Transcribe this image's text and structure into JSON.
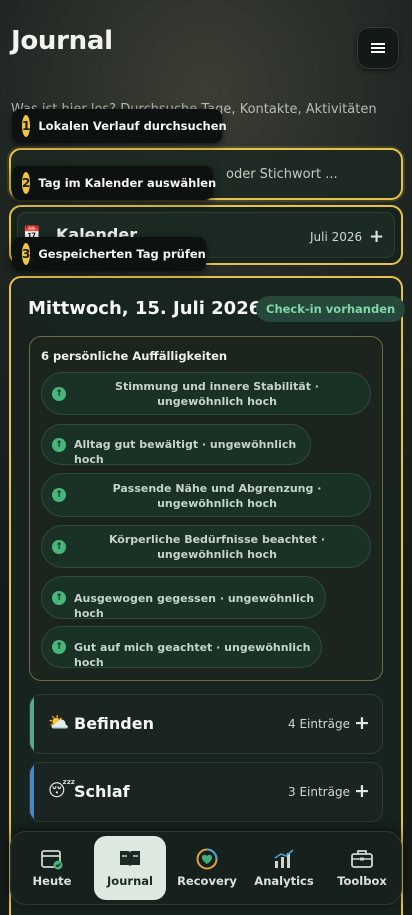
{
  "header": {
    "title": "Journal",
    "subtitle": "Was ist hier los? Durchsuche Tage, Kontakte, Aktivitäten"
  },
  "search": {
    "placeholder": "oder Stichwort ..."
  },
  "calendar": {
    "label": "Kalender",
    "month": "Juli 2026"
  },
  "tips": [
    {
      "number": "1",
      "text": "Lokalen Verlauf durchsuchen"
    },
    {
      "number": "2",
      "text": "Tag im Kalender auswählen"
    },
    {
      "number": "3",
      "text": "Gespeicherten Tag prüfen"
    }
  ],
  "day": {
    "title": "Mittwoch, 15. Juli 2026",
    "badge": "Check-in vorhanden",
    "anomalies_heading": "6 persönliche Auffälligkeiten",
    "anomalies": [
      "Stimmung und innere Stabilität · ungewöhnlich hoch",
      "Alltag gut bewältigt · ungewöhnlich hoch",
      "Passende Nähe und Abgrenzung · ungewöhnlich hoch",
      "Körperliche Bedürfnisse beachtet · ungewöhnlich hoch",
      "Ausgewogen gegessen · ungewöhnlich hoch",
      "Gut auf mich geachtet · ungewöhnlich hoch"
    ],
    "categories": [
      {
        "icon": "⛅",
        "label": "Befinden",
        "count": "4 Einträge",
        "accent": "#5aa58f"
      },
      {
        "icon": "😴",
        "label": "Schlaf",
        "count": "3 Einträge",
        "accent": "#4a86c9"
      }
    ]
  },
  "nav": [
    {
      "label": "Heute",
      "icon": "calendar-check-icon",
      "active": false
    },
    {
      "label": "Journal",
      "icon": "book-icon",
      "active": true
    },
    {
      "label": "Recovery",
      "icon": "heart-ring-icon",
      "active": false
    },
    {
      "label": "Analytics",
      "icon": "bar-chart-icon",
      "active": false
    },
    {
      "label": "Toolbox",
      "icon": "toolbox-icon",
      "active": false
    }
  ],
  "colors": {
    "highlight": "#e5c349",
    "badge_text": "#7fd6a8",
    "chip_dot": "#47b67a"
  }
}
